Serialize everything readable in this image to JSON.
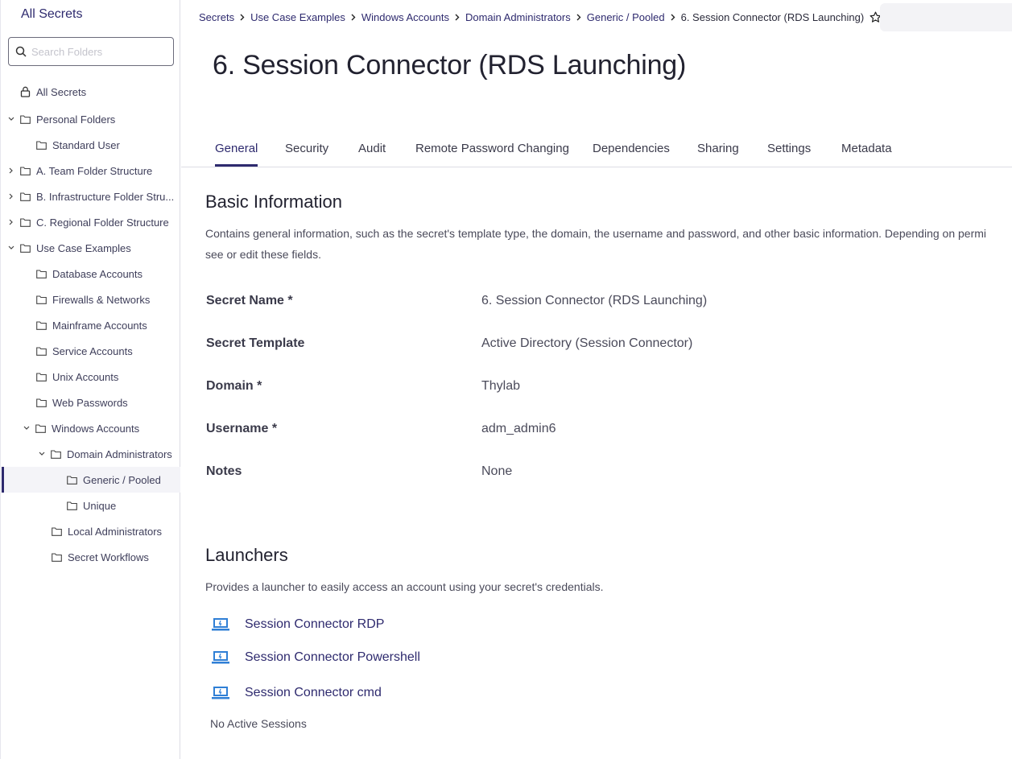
{
  "sidebar": {
    "title": "All Secrets",
    "search_placeholder": "Search Folders",
    "items": [
      {
        "label": "All Secrets",
        "icon": "lock-icon"
      },
      {
        "label": "Personal Folders",
        "icon": "folder-icon",
        "expanded": true
      },
      {
        "label": "Standard User",
        "icon": "folder-icon"
      },
      {
        "label": "A. Team Folder Structure",
        "icon": "folder-icon",
        "expanded": false
      },
      {
        "label": "B. Infrastructure Folder Stru...",
        "icon": "folder-icon",
        "expanded": false
      },
      {
        "label": "C. Regional Folder Structure",
        "icon": "folder-icon",
        "expanded": false
      },
      {
        "label": "Use Case Examples",
        "icon": "folder-icon",
        "expanded": true
      },
      {
        "label": "Database Accounts",
        "icon": "folder-icon"
      },
      {
        "label": "Firewalls & Networks",
        "icon": "folder-icon"
      },
      {
        "label": "Mainframe Accounts",
        "icon": "folder-icon"
      },
      {
        "label": "Service Accounts",
        "icon": "folder-icon"
      },
      {
        "label": "Unix Accounts",
        "icon": "folder-icon"
      },
      {
        "label": "Web Passwords",
        "icon": "folder-icon"
      },
      {
        "label": "Windows Accounts",
        "icon": "folder-icon",
        "expanded": true
      },
      {
        "label": "Domain Administrators",
        "icon": "folder-icon",
        "expanded": true
      },
      {
        "label": "Generic / Pooled",
        "icon": "folder-icon",
        "selected": true
      },
      {
        "label": "Unique",
        "icon": "folder-icon"
      },
      {
        "label": "Local Administrators",
        "icon": "folder-icon"
      },
      {
        "label": "Secret Workflows",
        "icon": "folder-icon"
      }
    ]
  },
  "breadcrumb": {
    "items": [
      "Secrets",
      "Use Case Examples",
      "Windows Accounts",
      "Domain Administrators",
      "Generic / Pooled"
    ],
    "current": "6. Session Connector (RDS Launching)"
  },
  "page": {
    "title": "6. Session Connector (RDS Launching)"
  },
  "tabs": [
    {
      "label": "General",
      "active": true
    },
    {
      "label": "Security"
    },
    {
      "label": "Audit"
    },
    {
      "label": "Remote Password Changing"
    },
    {
      "label": "Dependencies"
    },
    {
      "label": "Sharing"
    },
    {
      "label": "Settings"
    },
    {
      "label": "Metadata"
    }
  ],
  "basic_info": {
    "title": "Basic Information",
    "description_line1": "Contains general information, such as the secret's template type, the domain, the username and password, and other basic information. Depending on permi",
    "description_line2": "see or edit these fields.",
    "fields": [
      {
        "label": "Secret Name *",
        "value": "6. Session Connector (RDS Launching)"
      },
      {
        "label": "Secret Template",
        "value": "Active Directory (Session Connector)"
      },
      {
        "label": "Domain *",
        "value": "Thylab"
      },
      {
        "label": "Username *",
        "value": "adm_admin6"
      },
      {
        "label": "Notes",
        "value": "None"
      }
    ]
  },
  "launchers": {
    "title": "Launchers",
    "description": "Provides a launcher to easily access an account using your secret's credentials.",
    "items": [
      {
        "label": "Session Connector RDP",
        "icon": "laptop-icon"
      },
      {
        "label": "Session Connector Powershell",
        "icon": "laptop-icon"
      },
      {
        "label": "Session Connector cmd",
        "icon": "laptop-icon"
      }
    ],
    "sessions_text": "No Active Sessions"
  },
  "colors": {
    "brand": "#2e2a6e",
    "launcher_icon": "#2f7fd6"
  }
}
